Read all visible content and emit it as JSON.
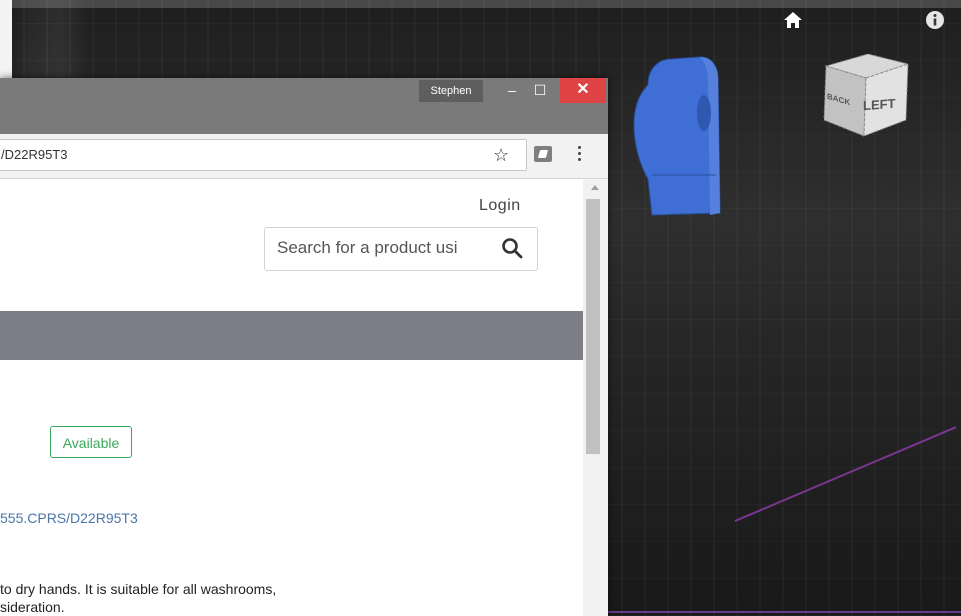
{
  "browser": {
    "profile_name": "Stephen",
    "window_controls": {
      "minimize": "–",
      "maximize": "☐",
      "close": "✕"
    },
    "address_bar": {
      "url": "/D22R95T3"
    },
    "icons": {
      "bookmark": "star-icon",
      "extension": "extension-icon",
      "menu": "menu-icon"
    }
  },
  "page": {
    "header": {
      "login_label": "Login"
    },
    "search": {
      "placeholder": "Search for a product usi",
      "icon": "search-icon"
    },
    "status_badge": "Available",
    "product_code_link": "555.CPRS/D22R95T3",
    "description": [
      "to dry hands. It is suitable for all washrooms,",
      "sideration."
    ],
    "colors": {
      "badge_green": "#39a85a",
      "link_blue": "#4a76a8",
      "nav_band": "#7d7e88"
    }
  },
  "viewer": {
    "view_cube": {
      "face_label": "LEFT",
      "side_label": "BACK"
    },
    "icons": {
      "home": "home-icon",
      "info": "info-icon"
    },
    "model_color": "#3f6fd4"
  }
}
